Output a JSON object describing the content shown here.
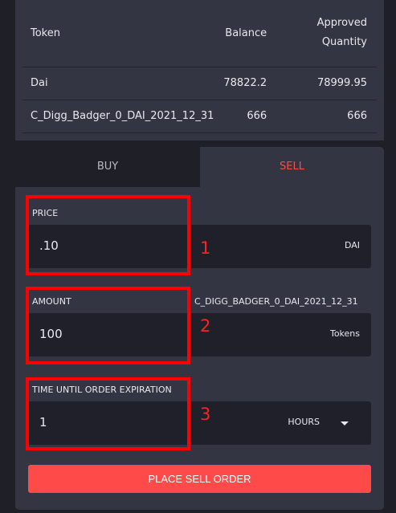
{
  "balances": {
    "headers": {
      "token": "Token",
      "balance": "Balance",
      "approved": "Approved Quantity"
    },
    "rows": [
      {
        "token": "Dai",
        "balance": "78822.2",
        "approved": "78999.95"
      },
      {
        "token": "C_Digg_Badger_0_DAI_2021_12_31",
        "balance": "666",
        "approved": "666"
      }
    ]
  },
  "order": {
    "tabs": {
      "buy": "BUY",
      "sell": "SELL"
    },
    "price": {
      "label": "PRICE",
      "value": ".10",
      "unit": "DAI"
    },
    "amount": {
      "label": "AMOUNT",
      "token": "C_DIGG_BADGER_0_DAI_2021_12_31",
      "value": "100",
      "unit": "Tokens"
    },
    "expiration": {
      "label": "TIME UNTIL ORDER EXPIRATION",
      "value": "1",
      "unit": "HOURS"
    },
    "submit": "PLACE SELL ORDER"
  },
  "annotations": [
    "1",
    "2",
    "3"
  ],
  "colors": {
    "accent": "#ff4a4a",
    "panel": "#343543",
    "background": "#1f1f27",
    "annotation": "#ff0000"
  }
}
